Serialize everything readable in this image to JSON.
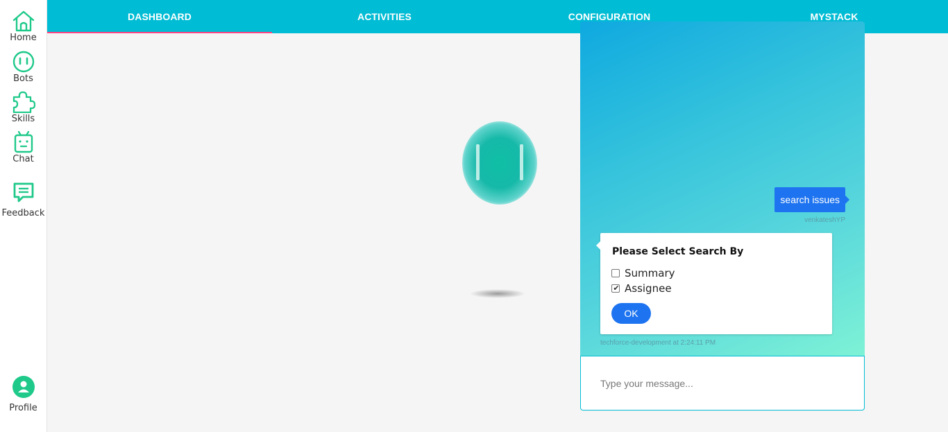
{
  "sidebar": {
    "items": [
      {
        "label": "Home",
        "icon": "home-icon"
      },
      {
        "label": "Bots",
        "icon": "bot-face-icon"
      },
      {
        "label": "Skills",
        "icon": "puzzle-icon"
      },
      {
        "label": "Chat",
        "icon": "robot-icon"
      },
      {
        "label": "Feedback",
        "icon": "feedback-icon"
      }
    ],
    "profile": {
      "label": "Profile",
      "icon": "profile-icon"
    }
  },
  "nav": {
    "tabs": [
      {
        "label": "DASHBOARD",
        "active": true
      },
      {
        "label": "ACTIVITIES",
        "active": false
      },
      {
        "label": "CONFIGURATION",
        "active": false
      },
      {
        "label": "MYSTACK",
        "active": false
      }
    ]
  },
  "chat": {
    "user_message": "search issues",
    "user_name": "venkateshYP",
    "card": {
      "title": "Please Select Search By",
      "options": [
        {
          "label": "Summary",
          "checked": false
        },
        {
          "label": "Assignee",
          "checked": true
        }
      ],
      "ok_label": "OK"
    },
    "bot_meta": "techforce-development at 2:24:11 PM",
    "input_placeholder": "Type your message..."
  },
  "colors": {
    "primary": "#00bcd4",
    "accent": "#ff4081",
    "icon_green": "#1ec98a",
    "button_blue": "#1e74f0"
  }
}
